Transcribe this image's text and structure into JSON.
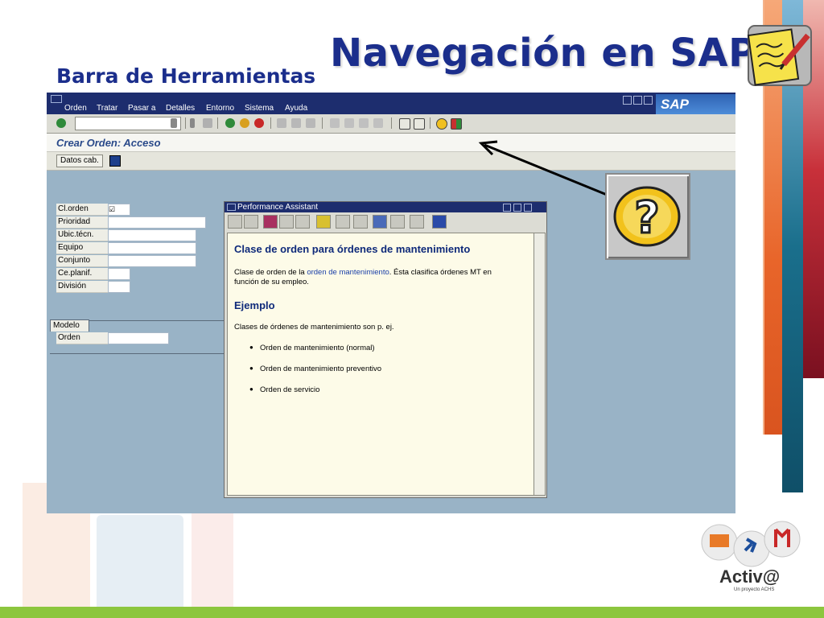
{
  "slide": {
    "title": "Navegación en SAP",
    "subtitle": "Barra de Herramientas"
  },
  "sap": {
    "menu": [
      "Orden",
      "Tratar",
      "Pasar a",
      "Detalles",
      "Entorno",
      "Sistema",
      "Ayuda"
    ],
    "logo": "SAP",
    "screen_title": "Crear Orden: Acceso",
    "app_button": "Datos cab.",
    "fields": [
      {
        "label": "Cl.orden",
        "value": "☑"
      },
      {
        "label": "Prioridad",
        "value": ""
      },
      {
        "label": "Ubic.técn.",
        "value": ""
      },
      {
        "label": "Equipo",
        "value": ""
      },
      {
        "label": "Conjunto",
        "value": ""
      },
      {
        "label": "Ce.planif.",
        "value": ""
      },
      {
        "label": "División",
        "value": ""
      }
    ],
    "model_tab": "Modelo",
    "model_field": "Orden"
  },
  "assistant": {
    "title": "Performance Assistant",
    "heading": "Clase de orden para órdenes de mantenimiento",
    "para_before": "Clase de orden de la ",
    "para_link": "orden de mantenimiento",
    "para_after": ". Ésta clasifica órdenes MT en",
    "para_line2": "función de su empleo.",
    "example_heading": "Ejemplo",
    "example_intro": "Clases de órdenes de mantenimiento son p. ej.",
    "examples": [
      "Orden de mantenimiento (normal)",
      "Orden de mantenimiento preventivo",
      "Orden de servicio"
    ]
  },
  "brand": {
    "name": "Activ@",
    "tagline": "Un proyecto ACHS"
  },
  "colors": {
    "title_blue": "#1b2e8c",
    "sap_bg": "#99b3c6",
    "menubar": "#1d2d6e",
    "stripe_orange": "#e8652a",
    "stripe_teal": "#1a6f8c",
    "stripe_red": "#a8182a",
    "footer_green": "#8cc63e"
  },
  "icons": [
    "notepad-pencil-icon",
    "help-question-icon",
    "enter-check-icon",
    "back-icon",
    "exit-icon",
    "cancel-icon",
    "print-icon",
    "find-icon",
    "new-session-icon",
    "shortcut-icon",
    "help-icon",
    "layout-icon"
  ]
}
